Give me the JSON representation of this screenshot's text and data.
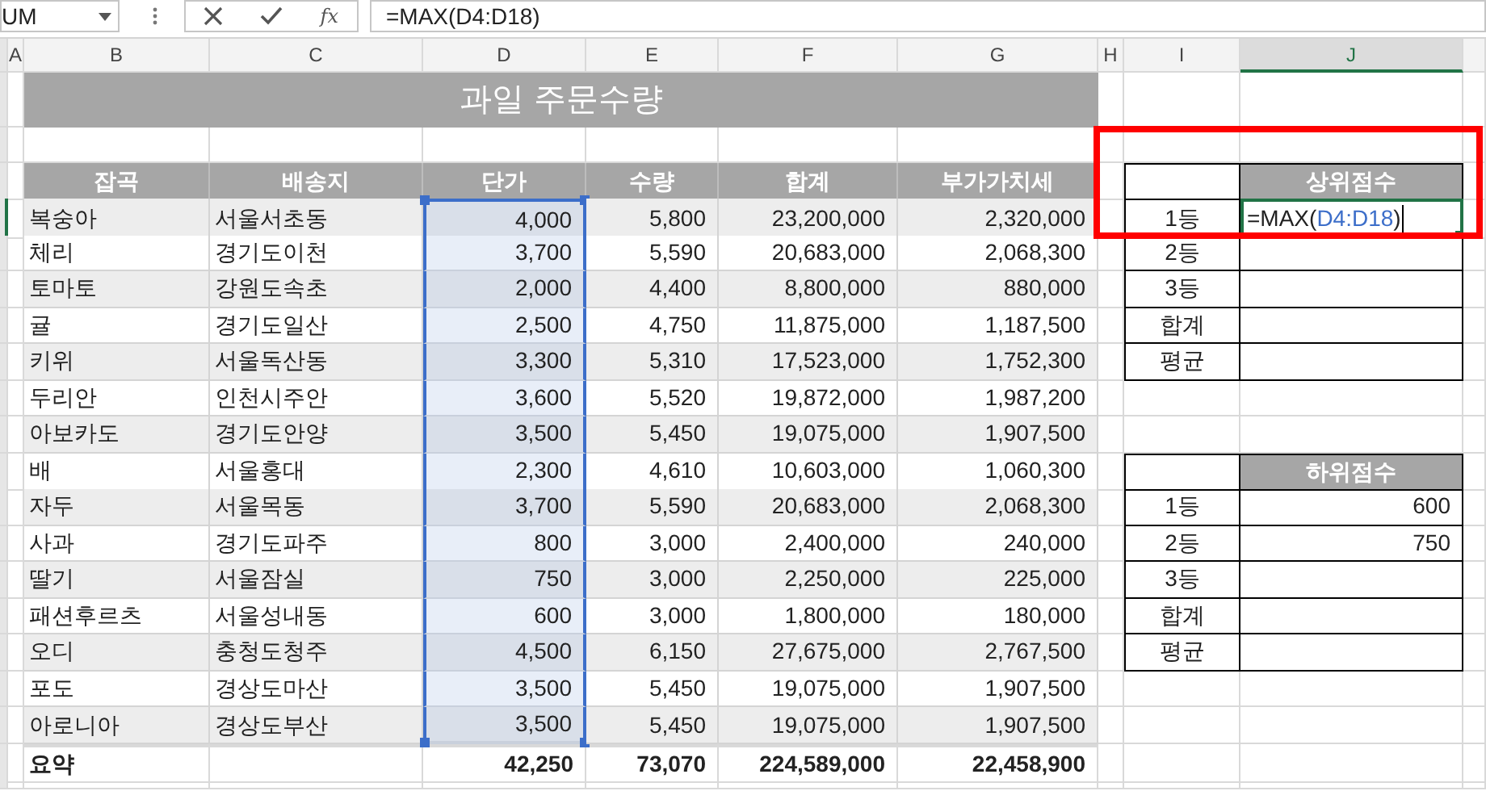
{
  "formula_bar": {
    "name_box": "UM",
    "function_label": "fx",
    "value": "=MAX(D4:D18)"
  },
  "column_headers": [
    {
      "label": "A",
      "selected": false
    },
    {
      "label": "B",
      "selected": false
    },
    {
      "label": "C",
      "selected": false
    },
    {
      "label": "D",
      "selected": false
    },
    {
      "label": "E",
      "selected": false
    },
    {
      "label": "F",
      "selected": false
    },
    {
      "label": "G",
      "selected": false
    },
    {
      "label": "H",
      "selected": false
    },
    {
      "label": "I",
      "selected": false
    },
    {
      "label": "J",
      "selected": true
    }
  ],
  "title": "과일 주문수량",
  "table": {
    "columns": [
      {
        "label": "잡곡",
        "selected": false
      },
      {
        "label": "배송지",
        "selected": false
      },
      {
        "label": "단가",
        "selected": true
      },
      {
        "label": "수량",
        "selected": false
      },
      {
        "label": "합계",
        "selected": false
      },
      {
        "label": "부가가치세",
        "selected": false
      }
    ],
    "rows": [
      [
        "복숭아",
        "서울서초동",
        "4,000",
        "5,800",
        "23,200,000",
        "2,320,000"
      ],
      [
        "체리",
        "경기도이천",
        "3,700",
        "5,590",
        "20,683,000",
        "2,068,300"
      ],
      [
        "토마토",
        "강원도속초",
        "2,000",
        "4,400",
        "8,800,000",
        "880,000"
      ],
      [
        "귤",
        "경기도일산",
        "2,500",
        "4,750",
        "11,875,000",
        "1,187,500"
      ],
      [
        "키위",
        "서울독산동",
        "3,300",
        "5,310",
        "17,523,000",
        "1,752,300"
      ],
      [
        "두리안",
        "인천시주안",
        "3,600",
        "5,520",
        "19,872,000",
        "1,987,200"
      ],
      [
        "아보카도",
        "경기도안양",
        "3,500",
        "5,450",
        "19,075,000",
        "1,907,500"
      ],
      [
        "배",
        "서울홍대",
        "2,300",
        "4,610",
        "10,603,000",
        "1,060,300"
      ],
      [
        "자두",
        "서울목동",
        "3,700",
        "5,590",
        "20,683,000",
        "2,068,300"
      ],
      [
        "사과",
        "경기도파주",
        "800",
        "3,000",
        "2,400,000",
        "240,000"
      ],
      [
        "딸기",
        "서울잠실",
        "750",
        "3,000",
        "2,250,000",
        "225,000"
      ],
      [
        "패션후르츠",
        "서울성내동",
        "600",
        "3,000",
        "1,800,000",
        "180,000"
      ],
      [
        "오디",
        "충청도청주",
        "4,500",
        "6,150",
        "27,675,000",
        "2,767,500"
      ],
      [
        "포도",
        "경상도마산",
        "3,500",
        "5,450",
        "19,075,000",
        "1,907,500"
      ],
      [
        "아로니아",
        "경상도부산",
        "3,500",
        "5,450",
        "19,075,000",
        "1,907,500"
      ]
    ],
    "summary": {
      "label": "요약",
      "values": [
        "42,250",
        "73,070",
        "224,589,000",
        "22,458,900"
      ]
    }
  },
  "top_ranking": {
    "title": "상위점수",
    "rows": [
      {
        "label": "1등",
        "editing": true,
        "formula": {
          "function": "=MAX(",
          "reference": "D4:D18",
          "close": ")"
        }
      },
      {
        "label": "2등",
        "editing": false
      },
      {
        "label": "3등",
        "editing": false
      },
      {
        "label": "합계",
        "editing": false
      },
      {
        "label": "평균",
        "editing": false
      }
    ]
  },
  "bottom_ranking": {
    "title": "하위점수",
    "rows": [
      {
        "label": "1등",
        "value": "600"
      },
      {
        "label": "2등",
        "value": "750"
      },
      {
        "label": "3등"
      },
      {
        "label": "합계"
      },
      {
        "label": "평균"
      }
    ]
  }
}
